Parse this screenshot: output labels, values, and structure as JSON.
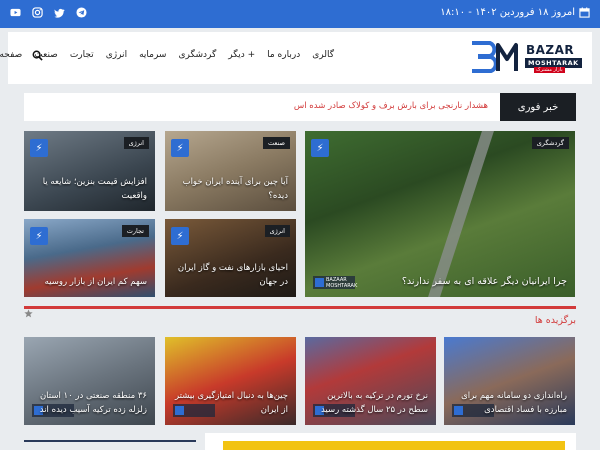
{
  "topbar": {
    "date": "امروز ۱۸ فروردین ۱۴۰۲ - ۱۸:۱۰",
    "color": "#2e6dd2"
  },
  "header": {
    "logo": {
      "line1": "BAZAR",
      "line2": "MOSHTARAK",
      "line3": "بازار مشترک"
    },
    "nav": [
      "صفحه نخست",
      "صنعت",
      "تجارت",
      "انرژی",
      "سرمایه",
      "گردشگری",
      "+ دیگر",
      "درباره ما",
      "گالری"
    ]
  },
  "breaking": {
    "label": "خبر فوری",
    "text": "هشدار نارنجی برای بارش برف و کولاک صادر شده اس"
  },
  "cards": {
    "big": {
      "category": "گردشگری",
      "title": "چرا ایرانیان دیگر علاقه ای به سفر ندارند؟",
      "watermark": "BAZAAR MOSHTARAK"
    },
    "c1": {
      "category": "صنعت",
      "title": "آیا چین برای آینده ایران خواب دیده؟"
    },
    "c2": {
      "category": "انرژی",
      "title": "افزایش قیمت بنزین؛ شایعه یا واقعیت"
    },
    "c3": {
      "category": "انرژی",
      "title": "احیای بازارهای نفت و گاز ایران در جهان"
    },
    "c4": {
      "category": "تجارت",
      "title": "سهم کم ایران از بازار روسیه"
    }
  },
  "featured": {
    "title": "برگزیده ها",
    "items": [
      {
        "title": "راه‌اندازی دو سامانه مهم برای مبارزه با فساد اقتصادی"
      },
      {
        "title": "نرخ تورم در ترکیه به بالاترین سطح در ۲۵ سال گذشته رسید"
      },
      {
        "title": "چین‌ها به دنبال امتیازگیری بیشتر از ایران"
      },
      {
        "title": "۳۶ منطقه صنعتی در ۱۰ استان زلزله زده ترکیه آسیب دیده اند"
      }
    ]
  },
  "colors": {
    "accent": "#2e6dd2",
    "alert": "#d23a3a",
    "dark": "#1b1f24"
  }
}
